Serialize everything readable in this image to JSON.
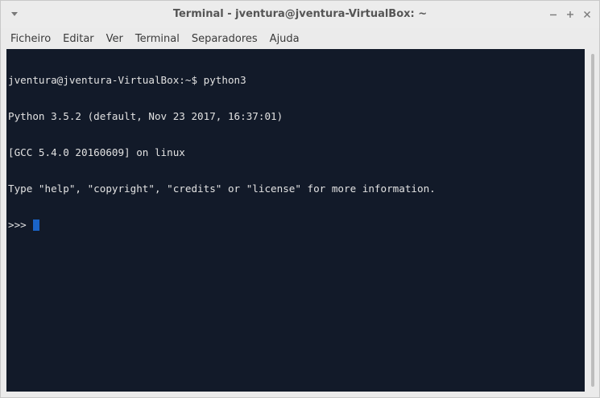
{
  "window": {
    "title": "Terminal - jventura@jventura-VirtualBox: ~"
  },
  "titlebar_icons": {
    "menu": "chevron-down-icon",
    "minimize": "minimize-icon",
    "maximize": "maximize-icon",
    "close": "close-icon"
  },
  "menubar": {
    "items": [
      "Ficheiro",
      "Editar",
      "Ver",
      "Terminal",
      "Separadores",
      "Ajuda"
    ]
  },
  "terminal": {
    "lines": [
      "jventura@jventura-VirtualBox:~$ python3",
      "Python 3.5.2 (default, Nov 23 2017, 16:37:01)",
      "[GCC 5.4.0 20160609] on linux",
      "Type \"help\", \"copyright\", \"credits\" or \"license\" for more information."
    ],
    "prompt": ">>>"
  },
  "colors": {
    "terminal_bg": "#121a29",
    "terminal_fg": "#e2e2e2",
    "cursor": "#1a64c8",
    "chrome": "#ebebeb"
  }
}
